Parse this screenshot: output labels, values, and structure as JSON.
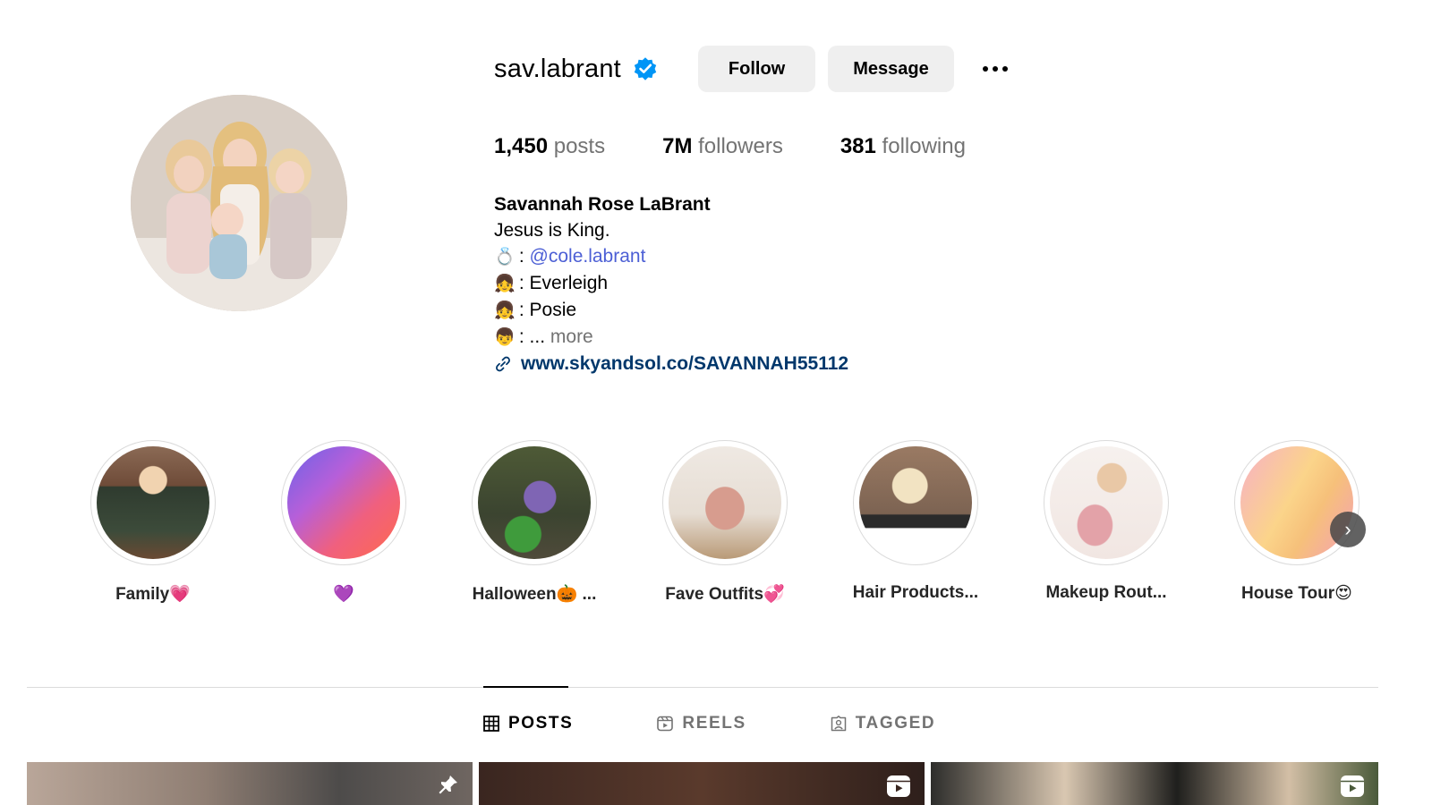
{
  "profile": {
    "username": "sav.labrant",
    "verified": true,
    "buttons": {
      "follow": "Follow",
      "message": "Message"
    },
    "stats": [
      {
        "value": "1,450",
        "label": "posts"
      },
      {
        "value": "7M",
        "label": "followers"
      },
      {
        "value": "381",
        "label": "following"
      }
    ],
    "bio": {
      "name": "Savannah Rose LaBrant",
      "tagline": "Jesus is King.",
      "lines": [
        {
          "emoji": "💍",
          "sep": ":",
          "text": "@cole.labrant"
        },
        {
          "emoji": "👧",
          "sep": ":",
          "text": "Everleigh"
        },
        {
          "emoji": "👧",
          "sep": ":",
          "text": "Posie"
        },
        {
          "emoji": "👦",
          "sep": ":",
          "text": "...",
          "more": "more"
        }
      ],
      "link": "www.skyandsol.co/SAVANNAH55112"
    }
  },
  "highlights": [
    {
      "label": "Family💗"
    },
    {
      "label": "💜"
    },
    {
      "label": "Halloween🎃 ..."
    },
    {
      "label": "Fave Outfits💞"
    },
    {
      "label": "Hair Products..."
    },
    {
      "label": "Makeup Rout..."
    },
    {
      "label": "House Tour😍"
    }
  ],
  "tabs": [
    {
      "label": "POSTS",
      "icon": "grid-icon",
      "active": true
    },
    {
      "label": "REELS",
      "icon": "reels-icon",
      "active": false
    },
    {
      "label": "TAGGED",
      "icon": "tagged-icon",
      "active": false
    }
  ],
  "colors": {
    "link": "#00376b",
    "mention": "#4c5fd5",
    "verified": "#0095f6",
    "secondary_text": "#737373",
    "button_bg": "#efefef"
  }
}
